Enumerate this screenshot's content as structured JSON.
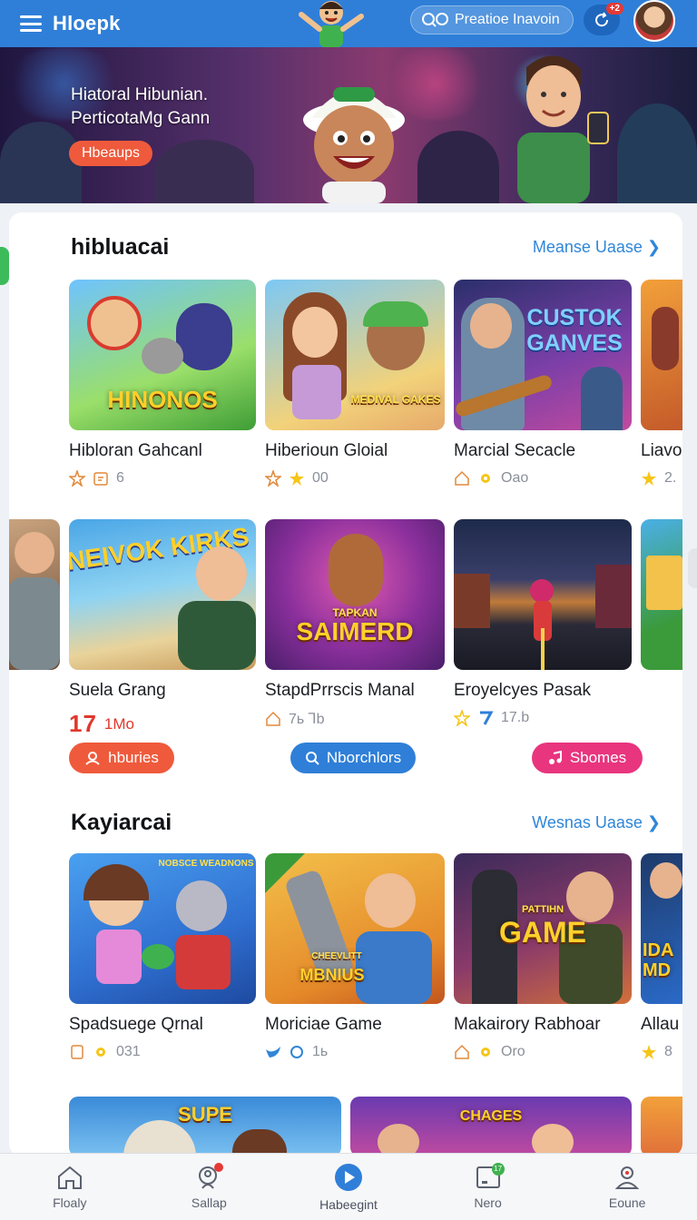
{
  "app": {
    "brand": "Hloepk",
    "accent": "#2f7fd8"
  },
  "topbar": {
    "search_label": "Preatioe Inavoin",
    "notification_count": "+2"
  },
  "hero": {
    "title_line1": "Hiatoral Hibunian.",
    "title_line2": "PerticotaMg Gann",
    "button_label": "Hbeaups"
  },
  "section1": {
    "title": "hibluacai",
    "see_all": "Meanse Uaase",
    "row1": [
      {
        "title": "Hibloran Gahcanl",
        "meta": "6",
        "thumb_text": "HINONOS"
      },
      {
        "title": "Hiberioun Gloial",
        "meta": "00",
        "thumb_text": "MEDIVAL GAKES"
      },
      {
        "title": "Marcial Secacle",
        "meta": "Oao",
        "thumb_text": "CUSTOK GANVES"
      },
      {
        "title": "Liavo",
        "meta": "2."
      }
    ],
    "row2": [
      {
        "title": "Suela Grang",
        "meta_big": "17",
        "meta": "1Mo",
        "thumb_text": "NEIVOK KIRKS"
      },
      {
        "title": "StapdPrrscis Manal",
        "meta": "7ь ⅂b",
        "thumb_text": "SAIMERD",
        "thumb_small": "TAPKAN"
      },
      {
        "title": "Eroyelcyes Pasak",
        "meta": "17.b"
      }
    ],
    "actions": [
      {
        "label": "hburies",
        "color": "#ef5a3c"
      },
      {
        "label": "Nborchlors",
        "color": "#2f7fd8"
      },
      {
        "label": "Sbomes",
        "color": "#e8357e"
      }
    ]
  },
  "section2": {
    "title": "Kayiarcai",
    "see_all": "Wesnas Uaase",
    "row": [
      {
        "title": "Spadsuege Qrnal",
        "meta": "031",
        "thumb_text": "NOBSCE WEADNONS"
      },
      {
        "title": "Moriciae Game",
        "meta": "1ь",
        "thumb_text": "MBNIUS",
        "thumb_small": "CHEEVLITT"
      },
      {
        "title": "Makairory Rabhoar",
        "meta": "Oro",
        "thumb_text": "GAME",
        "thumb_small": "PATTIHN"
      },
      {
        "title": "Allau",
        "meta": "8",
        "thumb_text": "IDA MD"
      }
    ],
    "row_partial": [
      {
        "thumb_text": "SUPE"
      },
      {
        "thumb_text": "CHAGES"
      }
    ]
  },
  "bottom_nav": [
    {
      "label": "Floaly",
      "icon": "home-icon"
    },
    {
      "label": "Sallap",
      "icon": "search-person-icon"
    },
    {
      "label": "Habeegint",
      "icon": "play-icon"
    },
    {
      "label": "Nero",
      "icon": "tablet-icon",
      "badge": "17"
    },
    {
      "label": "Eoune",
      "icon": "profile-icon"
    }
  ]
}
